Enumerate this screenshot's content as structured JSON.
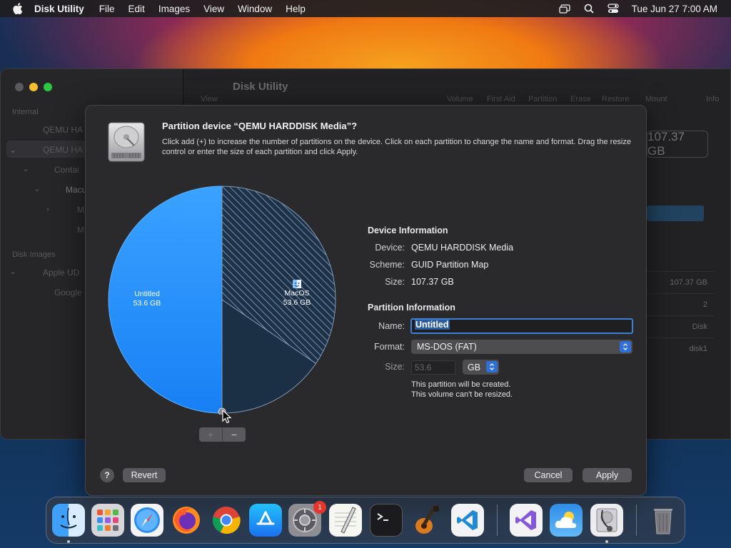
{
  "menubar": {
    "app_name": "Disk Utility",
    "items": [
      "File",
      "Edit",
      "Images",
      "View",
      "Window",
      "Help"
    ],
    "clock": "Tue Jun 27  7:00 AM"
  },
  "background_window": {
    "title": "Disk Utility",
    "sidebar_sections": [
      "Internal",
      "Disk Images"
    ],
    "sidebar_items": [
      "QEMU HA",
      "QEMU HA",
      "Contai",
      "Macu",
      "M",
      "M",
      "Apple UD",
      "Google"
    ],
    "toolbar": [
      "View",
      "Volume",
      "First Aid",
      "Partition",
      "Erase",
      "Restore",
      "Mount",
      "Info"
    ],
    "capacity": "107.37 GB",
    "table_values": [
      "107.37 GB",
      "2",
      "Disk",
      "disk1"
    ]
  },
  "sheet": {
    "title": "Partition device “QEMU HARDDISK Media”?",
    "description": "Click add (+) to increase the number of partitions on the device. Click on each partition to change the name and format. Drag the resize control or enter the size of each partition and click Apply.",
    "pie": {
      "slices": [
        {
          "name": "Untitled",
          "size": "53.6 GB",
          "fraction": 0.5,
          "color": "#1e90ff"
        },
        {
          "name": "MacOS",
          "size": "53.6 GB",
          "fraction": 0.5,
          "used_fraction": 0.31,
          "color": "#1b2f45"
        }
      ]
    },
    "device_info": {
      "heading": "Device Information",
      "device_label": "Device:",
      "device_value": "QEMU HARDDISK Media",
      "scheme_label": "Scheme:",
      "scheme_value": "GUID Partition Map",
      "size_label": "Size:",
      "size_value": "107.37 GB"
    },
    "partition_info": {
      "heading": "Partition Information",
      "name_label": "Name:",
      "name_value": "Untitled",
      "format_label": "Format:",
      "format_value": "MS-DOS (FAT)",
      "size_label": "Size:",
      "size_value": "53.6",
      "size_unit": "GB",
      "note_1": "This partition will be created.",
      "note_2": "This volume can't be resized."
    },
    "buttons": {
      "add": "+",
      "remove": "−",
      "help": "?",
      "revert": "Revert",
      "cancel": "Cancel",
      "apply": "Apply"
    }
  },
  "dock": {
    "apps": [
      "finder-icon",
      "launchpad-icon",
      "safari-icon",
      "firefox-icon",
      "chrome-icon",
      "app-store-icon",
      "system-preferences-icon",
      "textedit-icon",
      "terminal-icon",
      "garageband-icon",
      "vscode-icon",
      "visual-studio-icon",
      "weather-icon",
      "disk-utility-icon",
      "trash-icon"
    ],
    "system_preferences_badge": "1"
  }
}
